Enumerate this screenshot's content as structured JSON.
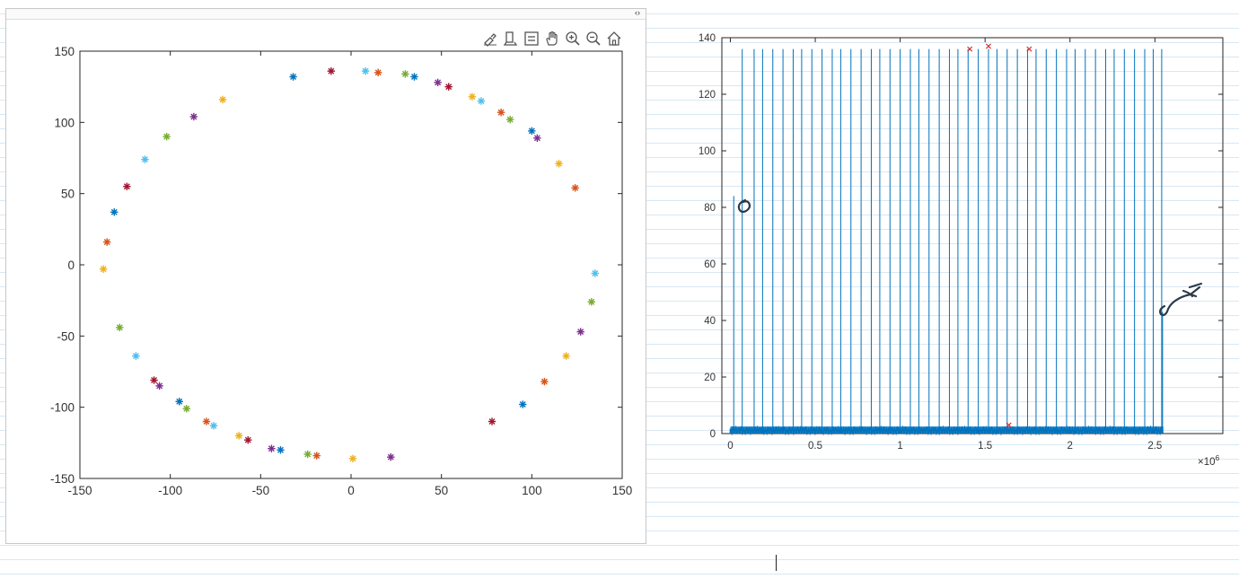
{
  "window": {
    "collapse_toggle": "‹›"
  },
  "toolbar": {
    "icons": [
      "brush-icon",
      "data-tips-icon",
      "legend-icon",
      "pan-icon",
      "zoom-in-icon",
      "zoom-out-icon",
      "home-icon"
    ]
  },
  "colors": {
    "matlab_series": [
      "#0072BD",
      "#D95319",
      "#EDB120",
      "#7E2F8E",
      "#77AC30",
      "#4DBEEE",
      "#A2142F"
    ],
    "line": "#0072BD",
    "marker_x": "#D62728",
    "annotation_ink": "#2b3a4a"
  },
  "chart_data": [
    {
      "type": "scatter",
      "marker": "*",
      "xlim": [
        -150,
        150
      ],
      "ylim": [
        -150,
        150
      ],
      "xticks": [
        "-150",
        "-100",
        "-50",
        "0",
        "50",
        "100",
        "150"
      ],
      "yticks": [
        "150",
        "100",
        "50",
        "0",
        "-50",
        "-100",
        "-150"
      ],
      "grid": false,
      "points": [
        {
          "x": -32,
          "y": 132,
          "c": 0
        },
        {
          "x": -11,
          "y": 136,
          "c": 6
        },
        {
          "x": 8,
          "y": 136,
          "c": 5
        },
        {
          "x": 15,
          "y": 135,
          "c": 1
        },
        {
          "x": 30,
          "y": 134,
          "c": 4
        },
        {
          "x": 35,
          "y": 132,
          "c": 0
        },
        {
          "x": 48,
          "y": 128,
          "c": 3
        },
        {
          "x": 54,
          "y": 125,
          "c": 6
        },
        {
          "x": 67,
          "y": 118,
          "c": 2
        },
        {
          "x": 72,
          "y": 115,
          "c": 5
        },
        {
          "x": 83,
          "y": 107,
          "c": 1
        },
        {
          "x": 88,
          "y": 102,
          "c": 4
        },
        {
          "x": 100,
          "y": 94,
          "c": 0
        },
        {
          "x": 103,
          "y": 89,
          "c": 3
        },
        {
          "x": 115,
          "y": 71,
          "c": 2
        },
        {
          "x": 124,
          "y": 54,
          "c": 1
        },
        {
          "x": -71,
          "y": 116,
          "c": 2
        },
        {
          "x": -87,
          "y": 104,
          "c": 3
        },
        {
          "x": -102,
          "y": 90,
          "c": 4
        },
        {
          "x": -114,
          "y": 74,
          "c": 5
        },
        {
          "x": -124,
          "y": 55,
          "c": 6
        },
        {
          "x": -131,
          "y": 37,
          "c": 0
        },
        {
          "x": -135,
          "y": 16,
          "c": 1
        },
        {
          "x": -137,
          "y": -3,
          "c": 2
        },
        {
          "x": 135,
          "y": -6,
          "c": 5
        },
        {
          "x": 133,
          "y": -26,
          "c": 4
        },
        {
          "x": 127,
          "y": -47,
          "c": 3
        },
        {
          "x": 119,
          "y": -64,
          "c": 2
        },
        {
          "x": 107,
          "y": -82,
          "c": 1
        },
        {
          "x": 95,
          "y": -98,
          "c": 0
        },
        {
          "x": 78,
          "y": -110,
          "c": 6
        },
        {
          "x": -128,
          "y": -44,
          "c": 4
        },
        {
          "x": -119,
          "y": -64,
          "c": 5
        },
        {
          "x": -109,
          "y": -81,
          "c": 6
        },
        {
          "x": -106,
          "y": -85,
          "c": 3
        },
        {
          "x": -95,
          "y": -96,
          "c": 0
        },
        {
          "x": -91,
          "y": -101,
          "c": 4
        },
        {
          "x": -80,
          "y": -110,
          "c": 1
        },
        {
          "x": -76,
          "y": -113,
          "c": 5
        },
        {
          "x": -62,
          "y": -120,
          "c": 2
        },
        {
          "x": -57,
          "y": -123,
          "c": 6
        },
        {
          "x": -44,
          "y": -129,
          "c": 3
        },
        {
          "x": -39,
          "y": -130,
          "c": 0
        },
        {
          "x": -24,
          "y": -133,
          "c": 4
        },
        {
          "x": -19,
          "y": -134,
          "c": 1
        },
        {
          "x": 1,
          "y": -136,
          "c": 2
        },
        {
          "x": 22,
          "y": -135,
          "c": 3
        }
      ]
    },
    {
      "type": "line",
      "xlim": [
        -0.05,
        2.9
      ],
      "ylim": [
        0,
        140
      ],
      "x_exponent_label": "×10",
      "x_exponent_power": "6",
      "xticks": [
        "0",
        "0.5",
        "1",
        "1.5",
        "2",
        "2.5"
      ],
      "xtick_values": [
        0,
        0.5,
        1,
        1.5,
        2,
        2.5
      ],
      "yticks": [
        "0",
        "20",
        "40",
        "60",
        "80",
        "100",
        "120",
        "140"
      ],
      "ytick_values": [
        0,
        20,
        40,
        60,
        80,
        100,
        120,
        140
      ],
      "spike_height": 136,
      "spikes_x": [
        0.02,
        0.07,
        0.14,
        0.19,
        0.25,
        0.31,
        0.37,
        0.42,
        0.48,
        0.54,
        0.6,
        0.65,
        0.71,
        0.77,
        0.83,
        0.88,
        0.94,
        1.0,
        1.06,
        1.11,
        1.17,
        1.23,
        1.29,
        1.34,
        1.4,
        1.46,
        1.52,
        1.57,
        1.63,
        1.69,
        1.75,
        1.8,
        1.86,
        1.92,
        1.98,
        2.03,
        2.09,
        2.15,
        2.21,
        2.26,
        2.32,
        2.38,
        2.44,
        2.49,
        2.54
      ],
      "first_spike_value": 84,
      "last_spike_value": 43,
      "noise_level": 2.5,
      "noise_end": 2.55,
      "markers_x": [
        {
          "x": 1.41,
          "y": 136
        },
        {
          "x": 1.52,
          "y": 137
        },
        {
          "x": 1.76,
          "y": 136
        },
        {
          "x": 1.64,
          "y": 3
        }
      ]
    }
  ]
}
